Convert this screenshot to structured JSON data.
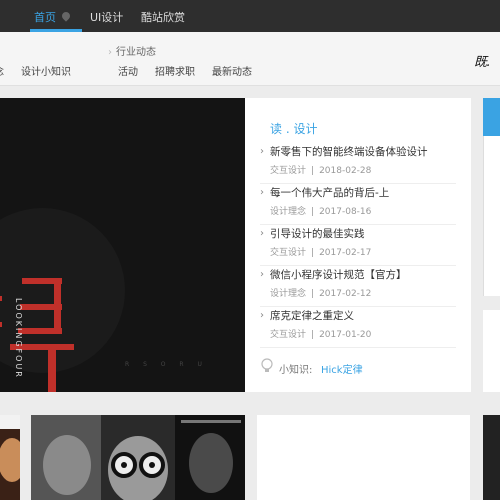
{
  "topnav": {
    "home": "首页",
    "ui_design": "UI设计",
    "cool_sites": "酷站欣赏"
  },
  "subnav": {
    "cut_text": "念",
    "design_tips": "设计小知识",
    "industry_news": "行业动态",
    "activity": "活动",
    "recruit": "招聘求职",
    "latest_news": "最新动态",
    "signature": "既."
  },
  "hero": {
    "vertical_text": "LOOKINGFOUR",
    "faint_text": "R S O R U"
  },
  "read": {
    "heading": "读 . 设计",
    "articles": [
      {
        "title": "新零售下的智能终端设备体验设计",
        "category": "交互设计",
        "date": "2018-02-28"
      },
      {
        "title": "每一个伟大产品的背后-上",
        "category": "设计理念",
        "date": "2017-08-16"
      },
      {
        "title": "引导设计的最佳实践",
        "category": "交互设计",
        "date": "2017-02-17"
      },
      {
        "title": "微信小程序设计规范【官方】",
        "category": "设计理念",
        "date": "2017-02-12"
      },
      {
        "title": "席克定律之重定义",
        "category": "交互设计",
        "date": "2017-01-20"
      }
    ],
    "separator": "|",
    "tip_label": "小知识:",
    "tip_value": "Hick定律"
  },
  "colors": {
    "accent": "#3aa3e3",
    "nav_bg": "#2e2e2e",
    "hero_red": "#c0302a"
  }
}
